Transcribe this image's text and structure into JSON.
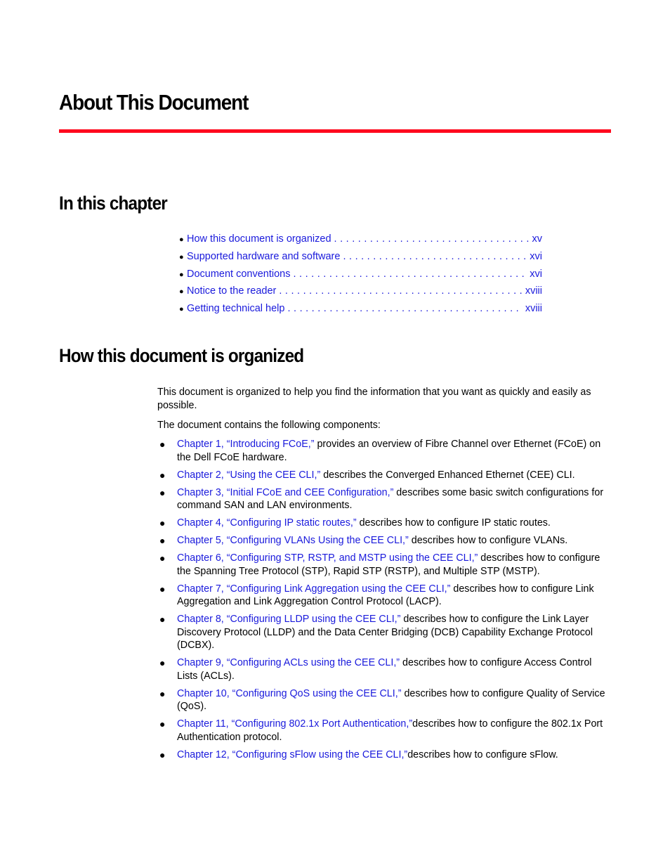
{
  "page": {
    "title": "About This Document",
    "accent_color": "#ff0a1e",
    "link_color": "#1a1adc"
  },
  "in_this_chapter": {
    "heading": "In this chapter",
    "items": [
      {
        "label": "How this document is organized",
        "page": "xv"
      },
      {
        "label": "Supported hardware and software",
        "page": "xvi"
      },
      {
        "label": "Document conventions",
        "page": "xvi"
      },
      {
        "label": "Notice to the reader",
        "page": "xviii"
      },
      {
        "label": "Getting technical help",
        "page": "xviii"
      }
    ]
  },
  "organized": {
    "heading": "How this document is organized",
    "intro": "This document is organized to help you find the information that you want as quickly and easily as possible.",
    "lead": "The document contains the following components:",
    "components": [
      {
        "link": "Chapter 1, “Introducing FCoE,”",
        "text": " provides an overview of Fibre Channel over Ethernet (FCoE) on the Dell FCoE hardware."
      },
      {
        "link": "Chapter 2, “Using the CEE CLI,”",
        "text": " describes the Converged Enhanced Ethernet (CEE) CLI."
      },
      {
        "link": "Chapter 3, “Initial FCoE and CEE Configuration,”",
        "text": " describes some basic switch configurations for command SAN and LAN environments."
      },
      {
        "link": "Chapter 4, “Configuring IP static routes,”",
        "text": " describes how to configure IP static routes."
      },
      {
        "link": "Chapter 5, “Configuring VLANs Using the CEE CLI,”",
        "text": " describes how to configure VLANs."
      },
      {
        "link": "Chapter 6, “Configuring STP, RSTP, and MSTP using the CEE CLI,”",
        "text": " describes how to configure the Spanning Tree Protocol (STP), Rapid STP (RSTP), and Multiple STP (MSTP)."
      },
      {
        "link": "Chapter 7, “Configuring Link Aggregation using the CEE CLI,”",
        "text": " describes how to configure Link Aggregation and Link Aggregation Control Protocol (LACP)."
      },
      {
        "link": "Chapter 8, “Configuring LLDP using the CEE CLI,”",
        "text": " describes how to configure the Link Layer Discovery Protocol (LLDP) and the Data Center Bridging (DCB) Capability Exchange Protocol (DCBX)."
      },
      {
        "link": "Chapter 9, “Configuring ACLs using the CEE CLI,”",
        "text": " describes how to configure Access Control Lists (ACLs)."
      },
      {
        "link": "Chapter 10, “Configuring QoS using the CEE CLI,”",
        "text": " describes how to configure Quality of Service (QoS)."
      },
      {
        "link": "Chapter 11, “Configuring 802.1x Port Authentication,”",
        "text": "describes how to configure the 802.1x Port Authentication protocol."
      },
      {
        "link": "Chapter 12, “Configuring sFlow using the CEE CLI,”",
        "text": "describes how to configure sFlow."
      }
    ]
  }
}
